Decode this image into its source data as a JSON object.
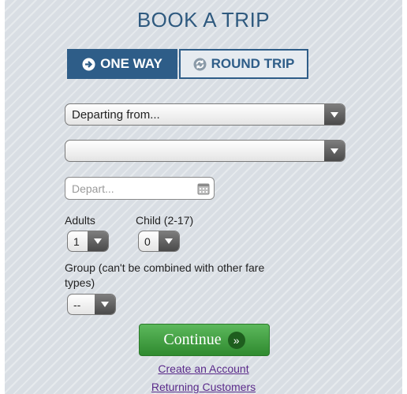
{
  "page": {
    "title": "BOOK A TRIP"
  },
  "trip_type": {
    "one_way": "ONE WAY",
    "round_trip": "ROUND TRIP",
    "selected": "one_way"
  },
  "form": {
    "departing_from": {
      "value": "Departing from..."
    },
    "destination": {
      "value": ""
    },
    "depart_date": {
      "placeholder": "Depart..."
    },
    "adults": {
      "label": "Adults",
      "value": "1"
    },
    "child": {
      "label": "Child (2-17)",
      "value": "0"
    },
    "group": {
      "label_line1": "Group (can't be combined with other fare",
      "label_line2": "types)",
      "value": "--"
    }
  },
  "actions": {
    "continue": "Continue",
    "continue_icon": "»",
    "create_account": "Create an Account",
    "returning_customers": "Returning Customers"
  },
  "colors": {
    "accent": "#2e5d88",
    "continue": "#3a9a3a",
    "link": "#5a2a8a"
  }
}
